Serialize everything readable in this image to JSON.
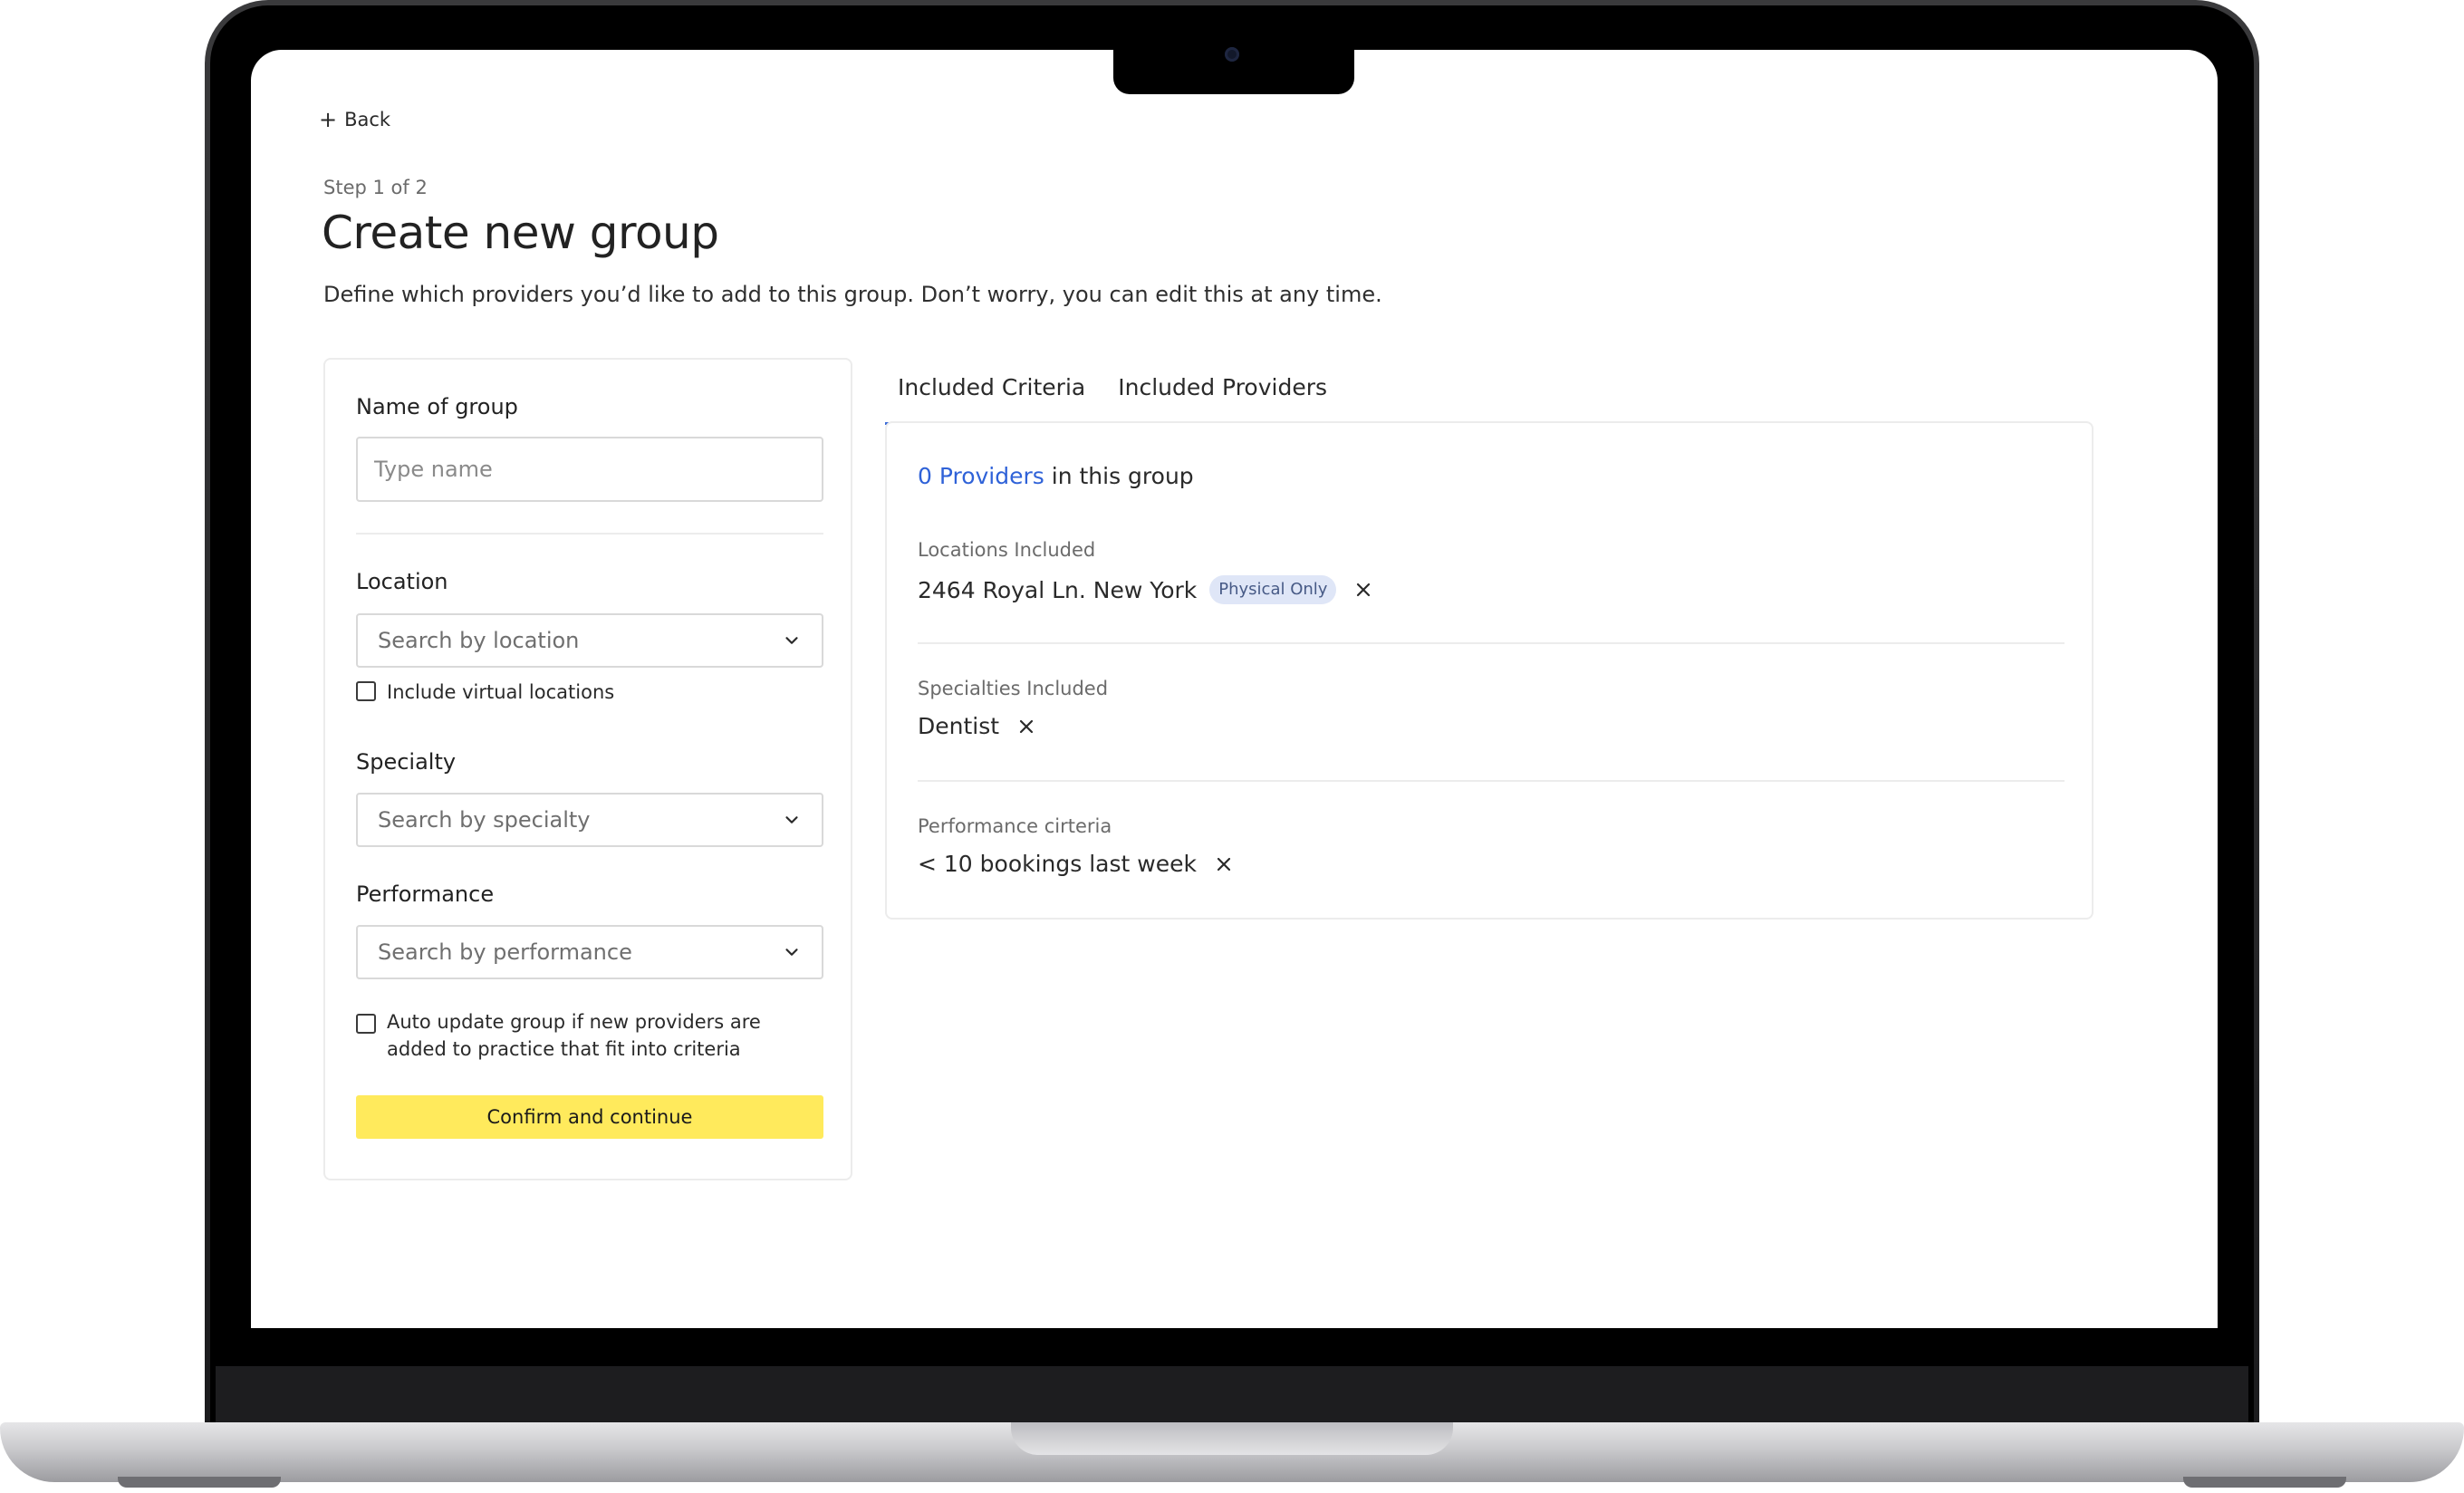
{
  "nav": {
    "back_label": "Back"
  },
  "header": {
    "step": "Step 1 of 2",
    "title": "Create new group",
    "subtitle": "Define which providers you’d like to add to this group. Don’t worry, you can edit this at any time."
  },
  "form": {
    "name_label": "Name of group",
    "name_placeholder": "Type name",
    "location_label": "Location",
    "location_placeholder": "Search by location",
    "virtual_checkbox_label": "Include virtual locations",
    "specialty_label": "Specialty",
    "specialty_placeholder": "Search by specialty",
    "performance_label": "Performance",
    "performance_placeholder": "Search by performance",
    "auto_update_label_line1": "Auto update group if new providers are",
    "auto_update_label_line2": "added to practice that fit into criteria",
    "confirm_label": "Confirm and continue"
  },
  "tabs": [
    {
      "label": "Included Criteria",
      "active": true
    },
    {
      "label": "Included Providers",
      "active": false
    }
  ],
  "criteria": {
    "providers_link": "0 Providers",
    "providers_suffix": " in this group",
    "locations_label": "Locations Included",
    "location_value": "2464 Royal Ln. New York",
    "location_badge": "Physical Only",
    "specialties_label": "Specialties Included",
    "specialty_value": "Dentist",
    "performance_label": "Performance cirteria",
    "performance_value": "< 10 bookings last week"
  },
  "colors": {
    "accent": "#2f62d8",
    "primary_button": "#ffea5c",
    "badge_bg": "#dfe6f7"
  }
}
